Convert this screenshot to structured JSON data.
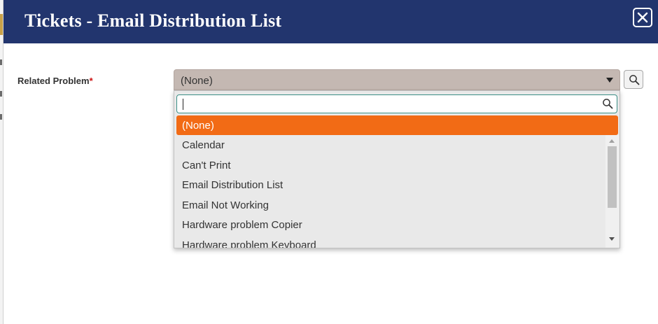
{
  "modal": {
    "title": "Tickets - Email Distribution List",
    "close_icon": "close-icon"
  },
  "field": {
    "label": "Related Problem",
    "required_mark": "*",
    "selected_value": "(None)",
    "lookup_icon": "search-icon"
  },
  "dropdown": {
    "search_value": "",
    "search_icon": "search-icon",
    "highlighted_option": "(None)",
    "options": [
      "Calendar",
      "Can't Print",
      "Email Distribution List",
      "Email Not Working",
      "Hardware problem Copier",
      "Hardware problem Keyboard"
    ]
  },
  "colors": {
    "header_bg": "#22356e",
    "highlight": "#f26b15",
    "required": "#cc1111"
  }
}
